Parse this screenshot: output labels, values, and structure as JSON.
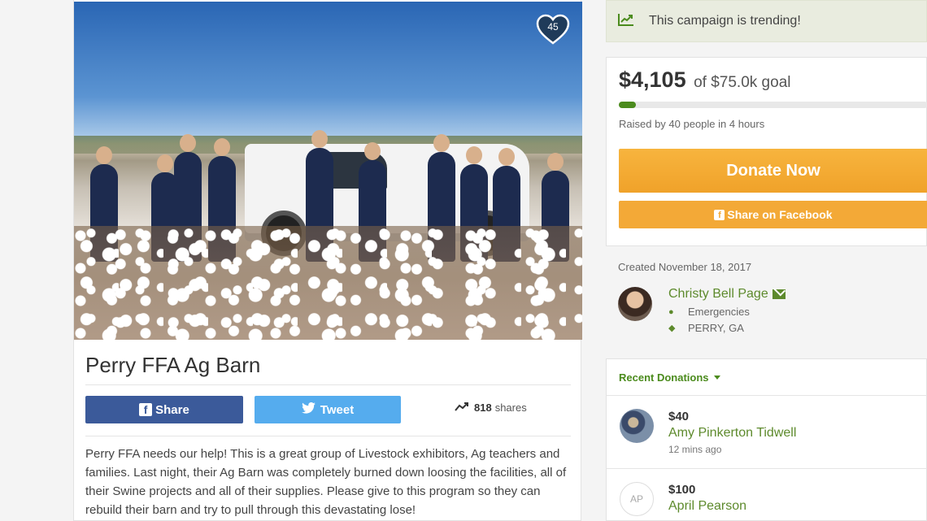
{
  "campaign": {
    "title": "Perry FFA Ag Barn",
    "hearts": "45",
    "description": "Perry FFA needs our help! This is a great group of Livestock exhibitors, Ag teachers and families. Last night, their Ag Barn was completely burned down loosing the facilities, all of their Swine projects and all of their supplies. Please give to this program so they can rebuild their barn and try to pull through this devastating lose!"
  },
  "share": {
    "facebook_label": "Share",
    "twitter_label": "Tweet",
    "shares_count": "818",
    "shares_suffix": "shares"
  },
  "trending": {
    "text": "This campaign is trending!"
  },
  "goal": {
    "raised": "$4,105",
    "goal_text": "of $75.0k goal",
    "progress_fraction": 0.055,
    "raised_by": "Raised by 40 people in 4 hours",
    "donate_label": "Donate Now",
    "facebook_share_label": "Share on Facebook"
  },
  "organizer": {
    "created": "Created November 18, 2017",
    "name": "Christy Bell Page",
    "category": "Emergencies",
    "location": "PERRY, GA"
  },
  "donations": {
    "header": "Recent Donations",
    "items": [
      {
        "amount": "$40",
        "name": "Amy Pinkerton Tidwell",
        "time": "12 mins ago"
      },
      {
        "amount": "$100",
        "name": "April Pearson",
        "initials": "AP"
      }
    ]
  },
  "colors": {
    "brand_green": "#4b8b1d",
    "donate_orange": "#f0a22a",
    "facebook_blue": "#3b5a9a",
    "twitter_blue": "#55acee"
  }
}
